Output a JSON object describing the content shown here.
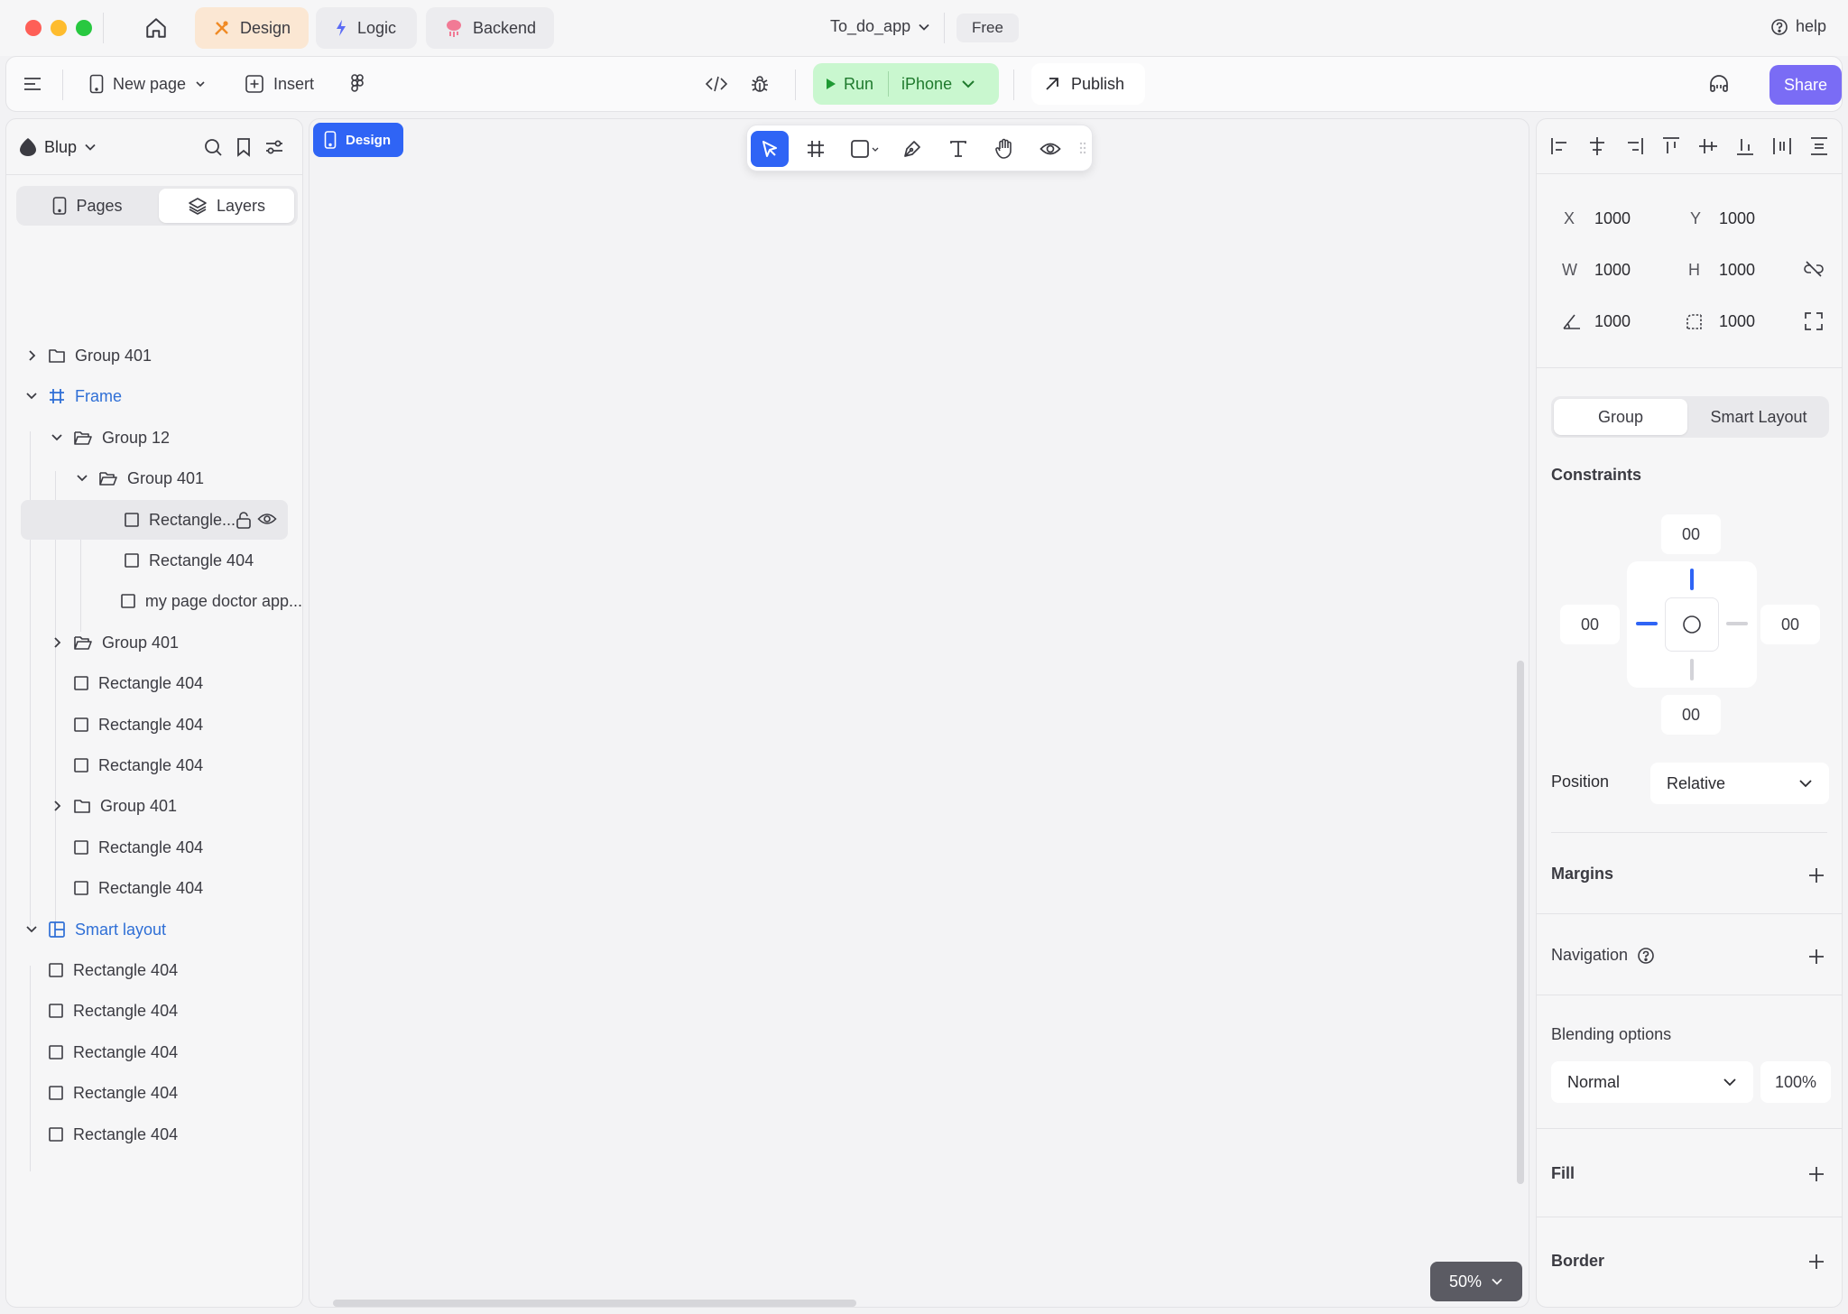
{
  "titlebar": {
    "modes": [
      {
        "label": "Design",
        "active": true
      },
      {
        "label": "Logic",
        "active": false
      },
      {
        "label": "Backend",
        "active": false
      }
    ],
    "project_name": "To_do_app",
    "plan": "Free",
    "help": "help"
  },
  "toolbar": {
    "new_page": "New page",
    "insert": "Insert",
    "run": "Run",
    "device": "iPhone",
    "publish": "Publish",
    "share": "Share"
  },
  "left_panel": {
    "workspace": "Blup",
    "tabs": {
      "pages": "Pages",
      "layers": "Layers"
    },
    "layers": [
      {
        "label": "Group 401",
        "icon": "folder-icon",
        "level": 0,
        "caret": "right"
      },
      {
        "label": "Frame",
        "icon": "frame-hash-icon",
        "level": 0,
        "caret": "down",
        "blue": true
      },
      {
        "label": "Group 12",
        "icon": "folder-open-icon",
        "level": 1,
        "caret": "down"
      },
      {
        "label": "Group 401",
        "icon": "folder-open-icon",
        "level": 2,
        "caret": "down"
      },
      {
        "label": "Rectangle...",
        "icon": "rectangle-icon",
        "level": 3,
        "selected": true
      },
      {
        "label": "Rectangle 404",
        "icon": "rectangle-icon",
        "level": 3
      },
      {
        "label": "my page doctor app...",
        "icon": "rectangle-icon",
        "level": 3
      },
      {
        "label": "Group 401",
        "icon": "folder-open-icon",
        "level": 1,
        "caret": "right"
      },
      {
        "label": "Rectangle 404",
        "icon": "rectangle-icon",
        "level": 1
      },
      {
        "label": "Rectangle 404",
        "icon": "rectangle-icon",
        "level": 1
      },
      {
        "label": "Rectangle 404",
        "icon": "rectangle-icon",
        "level": 1
      },
      {
        "label": "Group 401",
        "icon": "folder-icon",
        "level": 1,
        "caret": "right"
      },
      {
        "label": "Rectangle 404",
        "icon": "rectangle-icon",
        "level": 1
      },
      {
        "label": "Rectangle 404",
        "icon": "rectangle-icon",
        "level": 1
      },
      {
        "label": "Smart layout",
        "icon": "smart-layout-icon",
        "level": 0,
        "caret": "down",
        "blue": true
      },
      {
        "label": "Rectangle 404",
        "icon": "rectangle-icon",
        "level": 0
      },
      {
        "label": "Rectangle 404",
        "icon": "rectangle-icon",
        "level": 0
      },
      {
        "label": "Rectangle 404",
        "icon": "rectangle-icon",
        "level": 0
      },
      {
        "label": "Rectangle 404",
        "icon": "rectangle-icon",
        "level": 0
      },
      {
        "label": "Rectangle 404",
        "icon": "rectangle-icon",
        "level": 0
      }
    ]
  },
  "canvas": {
    "badge": "Design",
    "zoom": "50%"
  },
  "right_panel": {
    "props": {
      "x_label": "X",
      "x": "1000",
      "y_label": "Y",
      "y": "1000",
      "w_label": "W",
      "w": "1000",
      "h_label": "H",
      "h": "1000",
      "rotation": "1000",
      "radius": "1000"
    },
    "layout_tabs": {
      "group": "Group",
      "smart_layout": "Smart Layout"
    },
    "constraints": {
      "title": "Constraints",
      "top": "00",
      "left": "00",
      "right": "00",
      "bottom": "00"
    },
    "position": {
      "label": "Position",
      "value": "Relative"
    },
    "margins": "Margins",
    "navigation": "Navigation",
    "blending": {
      "title": "Blending options",
      "mode": "Normal",
      "opacity": "100%"
    },
    "fill": "Fill",
    "border": "Border"
  },
  "colors": {
    "accent_blue": "#2f64f5",
    "share_purple": "#7a6cf5",
    "run_green": "#c9f7cf",
    "design_tab": "#fbe7d3"
  }
}
